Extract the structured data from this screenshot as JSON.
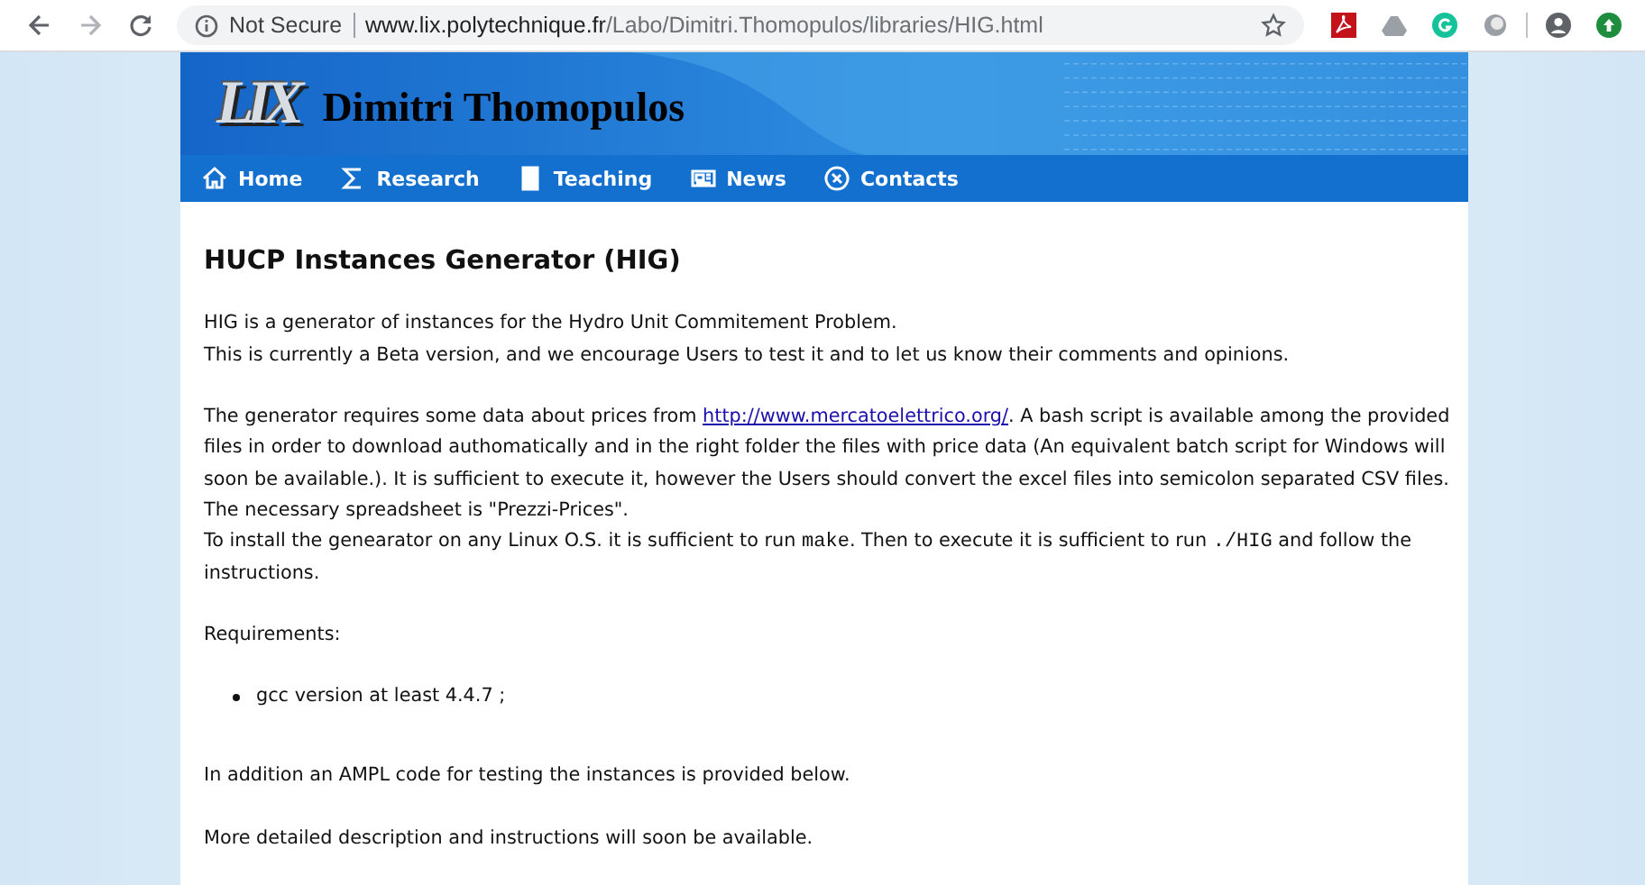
{
  "browser": {
    "security": "Not Secure",
    "url_host": "www.lix.polytechnique.fr",
    "url_path": "/Labo/Dimitri.Thomopulos/libraries/HIG.html"
  },
  "header": {
    "logo": "LIX",
    "title": "Dimitri Thomopulos"
  },
  "nav": [
    {
      "label": "Home"
    },
    {
      "label": "Research"
    },
    {
      "label": "Teaching"
    },
    {
      "label": "News"
    },
    {
      "label": "Contacts"
    }
  ],
  "content": {
    "heading": "HUCP Instances Generator (HIG)",
    "blocks": [
      {
        "kind": "para",
        "lines": [
          [
            {
              "kind": "text",
              "text": "HIG is a generator of instances for the Hydro Unit Commitement Problem."
            }
          ],
          [
            {
              "kind": "text",
              "text": "This is currently a Beta version, and we encourage Users to test it and to let us know their comments and opinions."
            }
          ]
        ]
      },
      {
        "kind": "para",
        "lines": [
          [
            {
              "kind": "text",
              "text": "The generator requires some data about prices from "
            },
            {
              "kind": "link",
              "text": "http://www.mercatoelettrico.org/"
            },
            {
              "kind": "text",
              "text": ". A bash script is available among the provided files in order to download authomatically and in the right folder the files with price data (An equivalent batch script for Windows will soon be available.). It is sufficient to execute it, however the Users should convert the excel files into semicolon separated CSV files. The necessary spreadsheet is \"Prezzi-Prices\"."
            }
          ],
          [
            {
              "kind": "text",
              "text": "To install the genearator on any Linux O.S. it is sufficient to run "
            },
            {
              "kind": "code",
              "text": "make"
            },
            {
              "kind": "text",
              "text": ". Then to execute it is sufficient to run "
            },
            {
              "kind": "code",
              "text": "./HIG"
            },
            {
              "kind": "text",
              "text": " and follow the instructions."
            }
          ]
        ]
      },
      {
        "kind": "para",
        "lines": [
          [
            {
              "kind": "text",
              "text": "Requirements:"
            }
          ]
        ]
      },
      {
        "kind": "list",
        "items": [
          "gcc version at least 4.4.7 ;"
        ]
      },
      {
        "kind": "para",
        "lines": [
          [
            {
              "kind": "text",
              "text": "In addition an AMPL code for testing the instances is provided below."
            }
          ]
        ]
      },
      {
        "kind": "para",
        "lines": [
          [
            {
              "kind": "text",
              "text": "More detailed description and instructions will soon be available."
            }
          ]
        ]
      }
    ]
  }
}
